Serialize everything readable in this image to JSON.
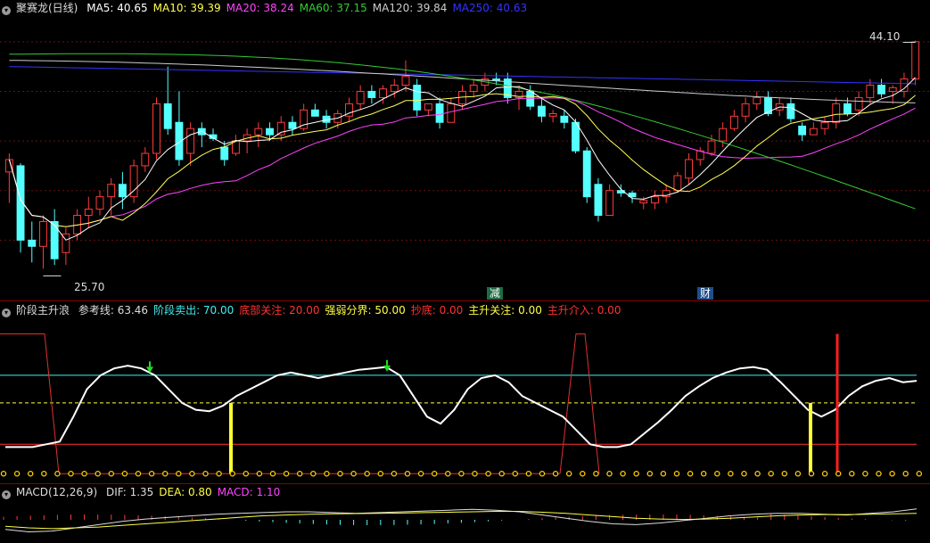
{
  "main": {
    "title": "聚赛龙(日线)",
    "ma": [
      {
        "label": "MA5: 40.65",
        "color": "#ffffff"
      },
      {
        "label": "MA10: 39.39",
        "color": "#ffff55"
      },
      {
        "label": "MA20: 38.24",
        "color": "#ff44ff"
      },
      {
        "label": "MA60: 37.15",
        "color": "#33cc33"
      },
      {
        "label": "MA120: 39.84",
        "color": "#cccccc"
      },
      {
        "label": "MA250: 40.63",
        "color": "#3333ff"
      }
    ],
    "high_label": "44.10",
    "low_label": "25.70",
    "markers": [
      "减",
      "财"
    ]
  },
  "mid": {
    "title": "阶段主升浪",
    "items": [
      {
        "label": "参考线: 63.46",
        "color": "#dddddd"
      },
      {
        "label": "阶段卖出: 70.00",
        "color": "#44eeee"
      },
      {
        "label": "底部关注: 20.00",
        "color": "#ff3333"
      },
      {
        "label": "强弱分界: 50.00",
        "color": "#ffff44"
      },
      {
        "label": "抄底: 0.00",
        "color": "#ff3333"
      },
      {
        "label": "主升关注: 0.00",
        "color": "#ffff44"
      },
      {
        "label": "主升介入: 0.00",
        "color": "#ff3333"
      }
    ]
  },
  "macd": {
    "title": "MACD(12,26,9)",
    "items": [
      {
        "label": "DIF: 1.35",
        "color": "#dddddd"
      },
      {
        "label": "DEA: 0.80",
        "color": "#ffff44"
      },
      {
        "label": "MACD: 1.10",
        "color": "#ff44ff"
      }
    ]
  },
  "chart_data": [
    {
      "type": "candlestick",
      "name": "聚赛龙(日线)",
      "ylim": [
        24.5,
        45.5
      ],
      "candles": [
        [
          33.5,
          35.0,
          31.0,
          34.5
        ],
        [
          34.0,
          34.2,
          27.0,
          28.0
        ],
        [
          28.0,
          29.5,
          26.2,
          27.5
        ],
        [
          27.5,
          30.0,
          25.7,
          29.5
        ],
        [
          29.5,
          30.5,
          26.0,
          26.5
        ],
        [
          27.0,
          29.0,
          26.0,
          28.5
        ],
        [
          28.5,
          30.5,
          28.0,
          30.0
        ],
        [
          30.0,
          31.5,
          29.0,
          30.5
        ],
        [
          30.5,
          32.0,
          30.0,
          31.5
        ],
        [
          31.5,
          33.0,
          30.0,
          32.5
        ],
        [
          32.5,
          33.5,
          30.5,
          31.5
        ],
        [
          31.5,
          34.5,
          31.0,
          34.0
        ],
        [
          34.0,
          35.5,
          33.5,
          35.0
        ],
        [
          35.0,
          39.5,
          34.5,
          39.0
        ],
        [
          39.0,
          42.0,
          36.5,
          37.0
        ],
        [
          37.5,
          40.0,
          34.0,
          34.5
        ],
        [
          35.0,
          37.5,
          34.0,
          37.0
        ],
        [
          37.0,
          37.5,
          35.5,
          36.5
        ],
        [
          36.5,
          37.0,
          36.0,
          36.2
        ],
        [
          35.5,
          36.0,
          34.0,
          34.5
        ],
        [
          35.0,
          36.5,
          34.8,
          36.0
        ],
        [
          36.0,
          37.0,
          35.0,
          36.5
        ],
        [
          36.5,
          37.5,
          35.5,
          37.0
        ],
        [
          37.0,
          37.5,
          36.0,
          36.5
        ],
        [
          36.5,
          38.0,
          36.0,
          37.5
        ],
        [
          37.5,
          38.0,
          36.5,
          37.0
        ],
        [
          37.0,
          39.0,
          36.8,
          38.5
        ],
        [
          38.5,
          39.0,
          38.0,
          38.0
        ],
        [
          38.0,
          38.5,
          37.0,
          37.5
        ],
        [
          37.5,
          38.5,
          37.0,
          38.2
        ],
        [
          38.0,
          39.5,
          37.5,
          39.0
        ],
        [
          39.0,
          40.5,
          38.5,
          40.0
        ],
        [
          40.0,
          40.5,
          39.0,
          39.5
        ],
        [
          39.5,
          40.5,
          39.0,
          40.2
        ],
        [
          40.0,
          41.0,
          39.5,
          40.5
        ],
        [
          40.5,
          42.5,
          40.0,
          41.2
        ],
        [
          40.5,
          41.0,
          38.0,
          38.5
        ],
        [
          38.5,
          39.0,
          38.0,
          39.0
        ],
        [
          39.0,
          39.5,
          37.0,
          37.5
        ],
        [
          37.5,
          39.5,
          37.5,
          39.0
        ],
        [
          39.0,
          40.5,
          38.5,
          40.0
        ],
        [
          40.0,
          41.0,
          39.5,
          40.5
        ],
        [
          40.5,
          41.5,
          40.0,
          41.0
        ],
        [
          41.0,
          41.5,
          40.5,
          40.9
        ],
        [
          41.0,
          41.5,
          39.0,
          39.5
        ],
        [
          39.5,
          40.5,
          38.5,
          40.0
        ],
        [
          40.0,
          40.5,
          38.5,
          38.8
        ],
        [
          38.8,
          39.5,
          37.5,
          38.0
        ],
        [
          38.0,
          38.5,
          37.5,
          38.2
        ],
        [
          38.0,
          38.5,
          37.0,
          37.5
        ],
        [
          37.5,
          37.8,
          35.0,
          35.2
        ],
        [
          35.2,
          35.5,
          31.0,
          31.5
        ],
        [
          32.5,
          33.0,
          29.5,
          30.0
        ],
        [
          30.0,
          32.5,
          30.0,
          32.0
        ],
        [
          32.0,
          32.5,
          31.5,
          31.8
        ],
        [
          31.8,
          32.0,
          31.0,
          31.5
        ],
        [
          31.0,
          31.5,
          30.5,
          31.2
        ],
        [
          31.0,
          32.0,
          30.5,
          31.5
        ],
        [
          31.5,
          32.5,
          31.0,
          32.0
        ],
        [
          32.0,
          33.5,
          31.8,
          33.2
        ],
        [
          33.0,
          35.0,
          32.5,
          34.5
        ],
        [
          34.5,
          35.5,
          34.0,
          35.2
        ],
        [
          35.0,
          36.5,
          34.8,
          36.0
        ],
        [
          36.0,
          37.5,
          35.5,
          37.0
        ],
        [
          37.0,
          38.5,
          36.8,
          38.0
        ],
        [
          38.0,
          39.5,
          37.5,
          39.0
        ],
        [
          39.0,
          40.0,
          38.5,
          39.5
        ],
        [
          39.5,
          40.0,
          38.0,
          38.2
        ],
        [
          38.5,
          39.5,
          38.0,
          39.0
        ],
        [
          39.0,
          39.5,
          37.5,
          37.8
        ],
        [
          37.2,
          37.5,
          36.0,
          36.5
        ],
        [
          36.5,
          37.5,
          36.5,
          37.0
        ],
        [
          37.0,
          38.0,
          36.5,
          37.5
        ],
        [
          37.5,
          39.5,
          37.0,
          39.0
        ],
        [
          39.0,
          39.5,
          38.0,
          38.2
        ],
        [
          38.5,
          40.0,
          38.0,
          39.5
        ],
        [
          39.5,
          41.0,
          39.0,
          40.5
        ],
        [
          40.5,
          41.0,
          39.5,
          39.8
        ],
        [
          40.0,
          40.5,
          39.0,
          40.3
        ],
        [
          40.0,
          41.5,
          39.5,
          41.0
        ],
        [
          41.0,
          44.1,
          40.5,
          44.0
        ]
      ]
    },
    {
      "type": "line",
      "name": "阶段主升浪",
      "ylim": [
        -5,
        110
      ],
      "reference_lines": [
        {
          "label": "阶段卖出",
          "value": 70
        },
        {
          "label": "强弱分界",
          "value": 50
        },
        {
          "label": "底部关注",
          "value": 20
        }
      ],
      "series": [
        {
          "name": "参考线",
          "values": [
            18,
            18,
            18,
            20,
            22,
            40,
            60,
            70,
            75,
            77,
            75,
            70,
            60,
            50,
            45,
            44,
            48,
            55,
            60,
            65,
            70,
            72,
            70,
            68,
            70,
            72,
            74,
            75,
            76,
            70,
            55,
            40,
            35,
            45,
            60,
            68,
            70,
            65,
            55,
            50,
            45,
            40,
            30,
            20,
            18,
            18,
            20,
            28,
            36,
            45,
            55,
            62,
            68,
            72,
            75,
            76,
            74,
            65,
            55,
            45,
            40,
            45,
            55,
            62,
            66,
            68,
            65,
            66
          ]
        },
        {
          "name": "信号线",
          "values": [
            100,
            100,
            100,
            100,
            0,
            0,
            0,
            0,
            0,
            0,
            0,
            0,
            0,
            0,
            0,
            0,
            0,
            0,
            0,
            0,
            0,
            0,
            0,
            0,
            0,
            0,
            0,
            0,
            0,
            0,
            0,
            0,
            0,
            0,
            0,
            0,
            0,
            0,
            0,
            0,
            0,
            0,
            0,
            0,
            0,
            0,
            0,
            0,
            0,
            0,
            0,
            0,
            0,
            0,
            0,
            0,
            0,
            0,
            0,
            0,
            0,
            0,
            0,
            0,
            0,
            0,
            0,
            0
          ]
        }
      ]
    },
    {
      "type": "line",
      "name": "MACD(12,26,9)",
      "series": [
        {
          "name": "DIF",
          "values": [
            -1.2,
            -1.5,
            -1.4,
            -1.0,
            -0.6,
            -0.2,
            0.1,
            0.3,
            0.5,
            0.7,
            0.8,
            0.9,
            1.0,
            1.0,
            0.9,
            0.8,
            0.9,
            1.0,
            1.1,
            1.2,
            1.3,
            1.2,
            1.0,
            0.6,
            0.2,
            -0.2,
            -0.5,
            -0.6,
            -0.4,
            -0.1,
            0.2,
            0.5,
            0.7,
            0.8,
            0.8,
            0.7,
            0.6,
            0.8,
            1.0,
            1.35
          ]
        },
        {
          "name": "DEA",
          "values": [
            -0.8,
            -1.0,
            -1.1,
            -1.0,
            -0.9,
            -0.7,
            -0.5,
            -0.3,
            -0.1,
            0.1,
            0.3,
            0.5,
            0.6,
            0.7,
            0.75,
            0.78,
            0.8,
            0.85,
            0.9,
            0.95,
            1.0,
            1.05,
            1.05,
            0.95,
            0.8,
            0.6,
            0.4,
            0.2,
            0.1,
            0.05,
            0.1,
            0.2,
            0.35,
            0.5,
            0.6,
            0.65,
            0.65,
            0.7,
            0.75,
            0.8
          ]
        }
      ]
    }
  ]
}
